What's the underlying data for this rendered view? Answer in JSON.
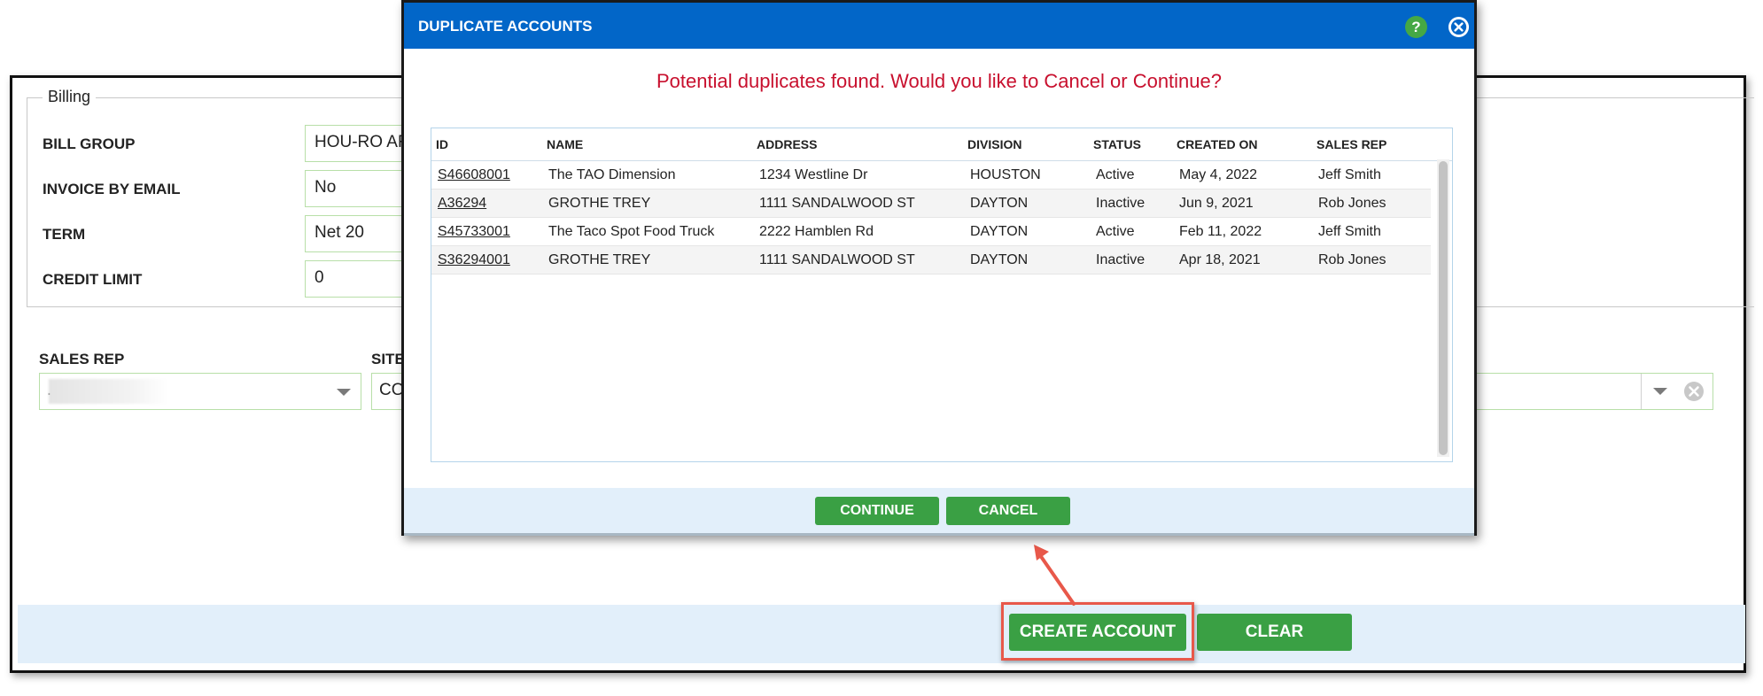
{
  "billing": {
    "legend": "Billing",
    "fields": [
      {
        "label": "BILL GROUP",
        "value": "HOU-RO ARR"
      },
      {
        "label": "INVOICE BY EMAIL",
        "value": "No"
      },
      {
        "label": "TERM",
        "value": "Net 20"
      },
      {
        "label": "CREDIT LIMIT",
        "value": "0"
      }
    ]
  },
  "sales_rep": {
    "label": "SALES REP",
    "value": "."
  },
  "site": {
    "label": "SITE",
    "value": "CO"
  },
  "footer": {
    "create_label": "CREATE ACCOUNT",
    "clear_label": "CLEAR"
  },
  "modal": {
    "title": "DUPLICATE ACCOUNTS",
    "help_glyph": "?",
    "message": "Potential duplicates found. Would you like to Cancel or Continue?",
    "columns": [
      "ID",
      "NAME",
      "ADDRESS",
      "DIVISION",
      "STATUS",
      "CREATED ON",
      "SALES REP"
    ],
    "rows": [
      [
        "S46608001",
        "The TAO Dimension",
        "1234 Westline Dr",
        "HOUSTON",
        "Active",
        "May 4, 2022",
        "Jeff Smith"
      ],
      [
        "A36294",
        "GROTHE TREY",
        "1111 SANDALWOOD ST",
        "DAYTON",
        "Inactive",
        "Jun 9, 2021",
        "Rob Jones"
      ],
      [
        "S45733001",
        "The Taco Spot Food Truck",
        "2222 Hamblen Rd",
        "DAYTON",
        "Active",
        "Feb 11, 2022",
        "Jeff Smith"
      ],
      [
        "S36294001",
        "GROTHE TREY",
        "1111 SANDALWOOD ST",
        "DAYTON",
        "Inactive",
        "Apr 18, 2021",
        "Rob Jones"
      ]
    ],
    "continue_label": "CONTINUE",
    "cancel_label": "CANCEL"
  },
  "colors": {
    "header_blue": "#0266c8",
    "message_red": "#c8102e",
    "button_green": "#3aa044",
    "annotation_red": "#e8584a",
    "footer_bg": "#e2effa"
  }
}
